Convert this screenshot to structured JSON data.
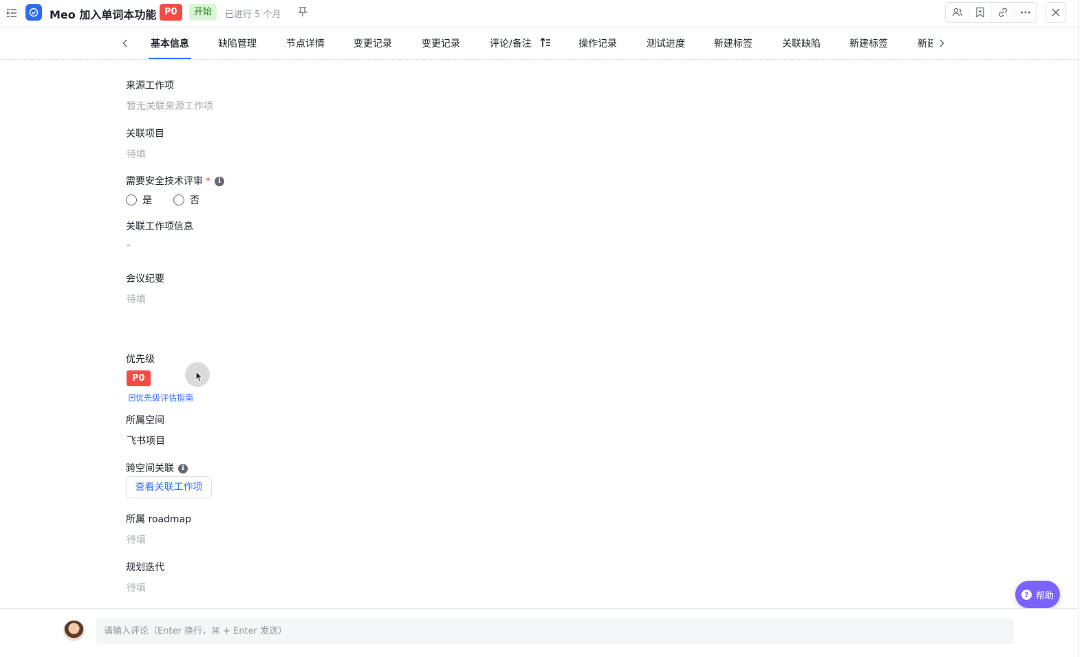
{
  "header": {
    "title": "Meo 加入单词本功能",
    "priority_badge": "P0",
    "status_badge": "开始",
    "duration": "已进行 5 个月"
  },
  "tabs": [
    {
      "label": "基本信息"
    },
    {
      "label": "缺陷管理"
    },
    {
      "label": "节点详情"
    },
    {
      "label": "变更记录"
    },
    {
      "label": "变更记录"
    },
    {
      "label": "评论/备注"
    },
    {
      "label": "操作记录"
    },
    {
      "label": "测试进度"
    },
    {
      "label": "新建标签"
    },
    {
      "label": "关联缺陷"
    },
    {
      "label": "新建标签"
    },
    {
      "label": "新建"
    }
  ],
  "fields": {
    "source_item": {
      "label": "来源工作项",
      "value": "暂无关联来源工作项"
    },
    "related_project": {
      "label": "关联项目",
      "value": "待填"
    },
    "security_review": {
      "label": "需要安全技术评审",
      "required_mark": "*",
      "options": [
        "是",
        "否"
      ]
    },
    "related_item_info": {
      "label": "关联工作项信息",
      "value": "-"
    },
    "meeting_notes": {
      "label": "会议纪要",
      "value": "待填"
    },
    "priority": {
      "label": "优先级",
      "value": "P0",
      "guide_link": "优先级评估指南"
    },
    "space": {
      "label": "所属空间",
      "value": "飞书项目"
    },
    "cross_space": {
      "label": "跨空间关联",
      "button": "查看关联工作项"
    },
    "roadmap": {
      "label": "所属 roadmap",
      "value": "待填"
    },
    "iteration": {
      "label": "规划迭代",
      "value": "待填"
    }
  },
  "help": {
    "label": "帮助"
  },
  "comment": {
    "placeholder": "请输入评论（Enter 换行，⌘ + Enter 发送）"
  },
  "colors": {
    "accent": "#3370ff",
    "danger": "#f54a45",
    "help": "#7b63ff",
    "success_bg": "#d9f5d6"
  }
}
